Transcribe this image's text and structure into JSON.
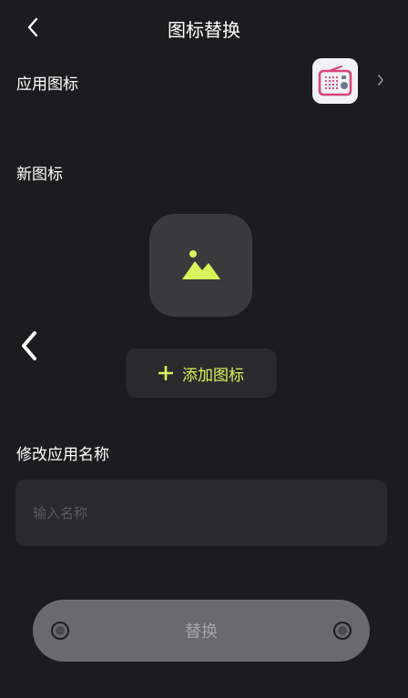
{
  "header": {
    "title": "图标替换",
    "back_icon": "chevron-left-icon"
  },
  "app_icon_row": {
    "label": "应用图标",
    "icon": "radio-icon",
    "chevron_icon": "chevron-right-icon"
  },
  "new_icon": {
    "label": "新图标",
    "placeholder_icon": "image-icon"
  },
  "add_icon_button": {
    "label": "添加图标",
    "icon": "plus-icon"
  },
  "rename": {
    "label": "修改应用名称",
    "placeholder": "输入名称",
    "value": ""
  },
  "replace_button": {
    "label": "替换"
  },
  "colors": {
    "background": "#1c1c1e",
    "accent": "#d6f55a",
    "card": "#2a2a2c",
    "radio_pink": "#d9457a"
  }
}
